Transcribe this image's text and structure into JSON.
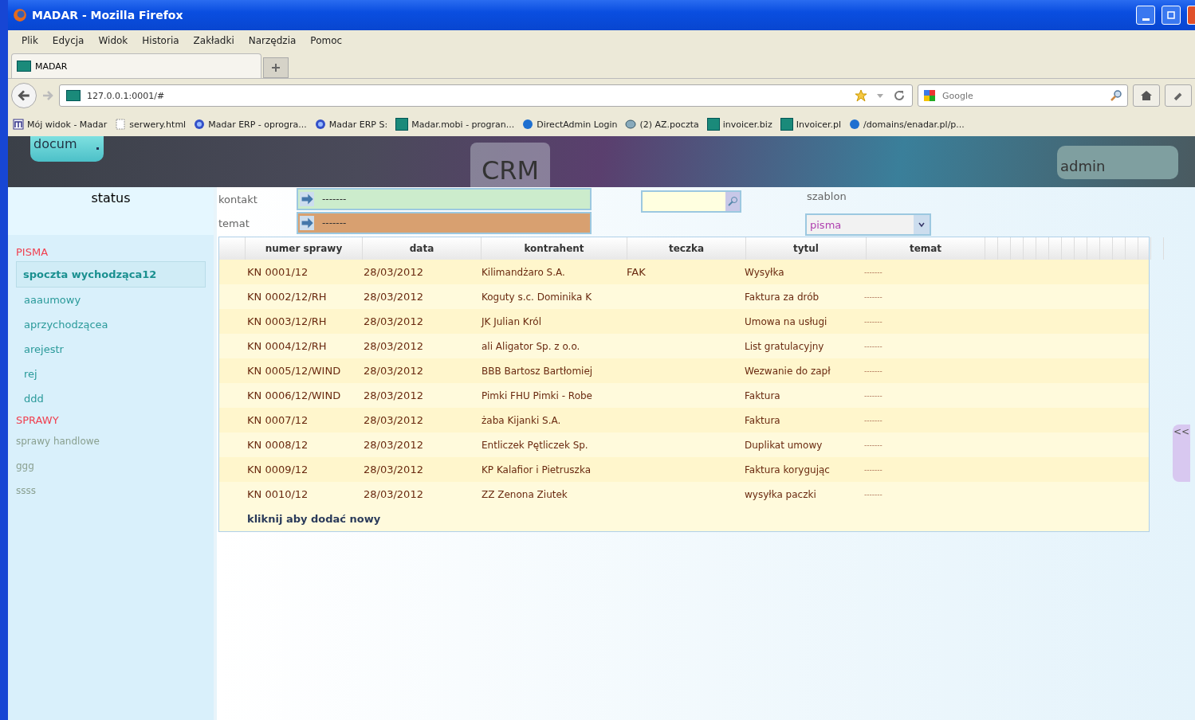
{
  "window": {
    "title": "MADAR - Mozilla Firefox"
  },
  "menu": [
    "Plik",
    "Edycja",
    "Widok",
    "Historia",
    "Zakładki",
    "Narzędzia",
    "Pomoc"
  ],
  "tabs": [
    {
      "label": "MADAR",
      "selected": true
    }
  ],
  "address": {
    "value": "127.0.0.1:0001/#"
  },
  "search": {
    "placeholder": "Google"
  },
  "bookmarks": [
    {
      "label": "Mój widok - Madar",
      "kind": "m"
    },
    {
      "label": "serwery.html",
      "kind": "page"
    },
    {
      "label": "Madar ERP - oprogra...",
      "kind": "globe"
    },
    {
      "label": "Madar ERP S:",
      "kind": "globe"
    },
    {
      "label": "Madar.mobi - progran...",
      "kind": "app"
    },
    {
      "label": "DirectAdmin Login",
      "kind": "dot"
    },
    {
      "label": "(2) AZ.poczta",
      "kind": "mail"
    },
    {
      "label": "invoicer.biz",
      "kind": "app"
    },
    {
      "label": "Invoicer.pl",
      "kind": "app"
    },
    {
      "label": "/domains/enadar.pl/p...",
      "kind": "dot"
    }
  ],
  "header": {
    "module_select": "docum",
    "title": "CRM",
    "user": "admin"
  },
  "sidebar": {
    "title": "status",
    "sections": [
      {
        "label": "PISMA",
        "kind": "pisma",
        "items": [
          {
            "label": "spoczta wychodząca12",
            "selected": true
          },
          {
            "label": "aaaumowy",
            "selected": false
          },
          {
            "label": "aprzychodzącea",
            "selected": false
          },
          {
            "label": "arejestr",
            "selected": false
          },
          {
            "label": "rej",
            "selected": false
          },
          {
            "label": "ddd",
            "selected": false
          }
        ]
      },
      {
        "label": "SPRAWY",
        "kind": "sprawy",
        "items": [
          {
            "label": "sprawy handlowe",
            "selected": false
          },
          {
            "label": "ggg",
            "selected": false
          },
          {
            "label": "ssss",
            "selected": false
          }
        ]
      }
    ]
  },
  "filters": {
    "kontakt": {
      "label": "kontakt",
      "value": "-------"
    },
    "temat": {
      "label": "temat",
      "value": "-------"
    },
    "szablon": {
      "label": "szablon",
      "value": "pisma"
    }
  },
  "table": {
    "columns": [
      "numer sprawy",
      "data",
      "kontrahent",
      "teczka",
      "tytul",
      "temat"
    ],
    "rows": [
      [
        "KN 0001/12",
        "28/03/2012",
        "Kilimandżaro S.A.",
        "FAK",
        "Wysyłka",
        "-------"
      ],
      [
        "KN 0002/12/RH",
        "28/03/2012",
        "Koguty s.c. Dominika K",
        "",
        "Faktura za drób",
        "-------"
      ],
      [
        "KN 0003/12/RH",
        "28/03/2012",
        "JK Julian Król",
        "",
        "Umowa na usługi",
        "-------"
      ],
      [
        "KN 0004/12/RH",
        "28/03/2012",
        "ali Aligator Sp. z o.o.",
        "",
        "List gratulacyjny",
        "-------"
      ],
      [
        "KN 0005/12/WIND",
        "28/03/2012",
        "BBB Bartosz Bartłomiej",
        "",
        "Wezwanie do zapł",
        "-------"
      ],
      [
        "KN 0006/12/WIND",
        "28/03/2012",
        "Pimki FHU Pimki - Robe",
        "",
        "Faktura",
        "-------"
      ],
      [
        "KN 0007/12",
        "28/03/2012",
        "żaba Kijanki S.A.",
        "",
        "Faktura",
        "-------"
      ],
      [
        "KN 0008/12",
        "28/03/2012",
        "Entliczek Pętliczek Sp.",
        "",
        "Duplikat umowy",
        "-------"
      ],
      [
        "KN 0009/12",
        "28/03/2012",
        "KP Kalafior i Pietruszka",
        "",
        "Faktura korygując",
        "-------"
      ],
      [
        "KN 0010/12",
        "28/03/2012",
        "ZZ Zenona Ziutek",
        "",
        "wysyłka paczki",
        "-------"
      ]
    ],
    "add_link": "kliknij aby dodać nowy"
  },
  "collapse_handle": "<<"
}
